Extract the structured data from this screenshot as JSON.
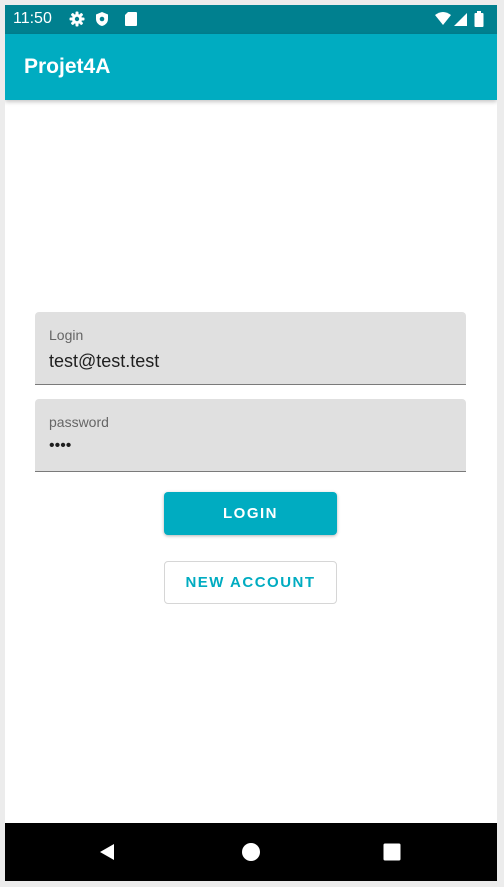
{
  "status_bar": {
    "time": "11:50",
    "left_icons": [
      "gear-icon",
      "shield-icon",
      "sd-card-icon"
    ],
    "right_icons": [
      "wifi-icon",
      "signal-icon",
      "battery-icon"
    ],
    "background": "#00808f"
  },
  "app_bar": {
    "title": "Projet4A",
    "background": "#00acc1"
  },
  "form": {
    "login": {
      "label": "Login",
      "value": "test@test.test"
    },
    "password": {
      "label": "password",
      "value": "••••"
    }
  },
  "buttons": {
    "login": "LOGIN",
    "new_account": "NEW ACCOUNT"
  },
  "nav_bar": {
    "items": [
      "back-icon",
      "home-icon",
      "recents-icon"
    ]
  },
  "colors": {
    "accent": "#00acc1",
    "field_bg": "#e0e0e0"
  }
}
